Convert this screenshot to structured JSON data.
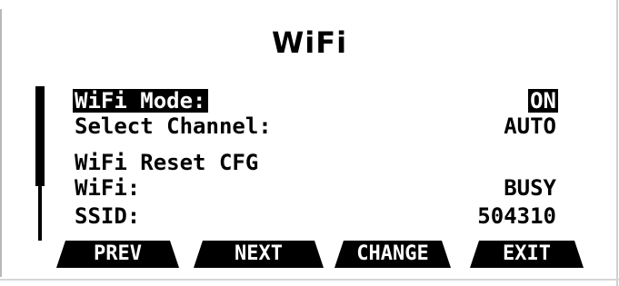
{
  "screen": {
    "title": "WiFi"
  },
  "menu": {
    "items": [
      {
        "label": "WiFi Mode:",
        "value": "ON",
        "selected": true
      },
      {
        "label": "Select Channel:",
        "value": "AUTO",
        "selected": false
      },
      {
        "label": "WiFi Reset CFG",
        "value": "",
        "selected": false
      },
      {
        "label": "WiFi:",
        "value": "BUSY",
        "selected": false
      },
      {
        "label": "SSID:",
        "value": "504310",
        "selected": false
      }
    ]
  },
  "softkeys": [
    {
      "label": "PREV"
    },
    {
      "label": "NEXT"
    },
    {
      "label": "CHANGE"
    },
    {
      "label": "EXIT"
    }
  ],
  "colors": {
    "background": "#ffffff",
    "foreground": "#000000"
  }
}
